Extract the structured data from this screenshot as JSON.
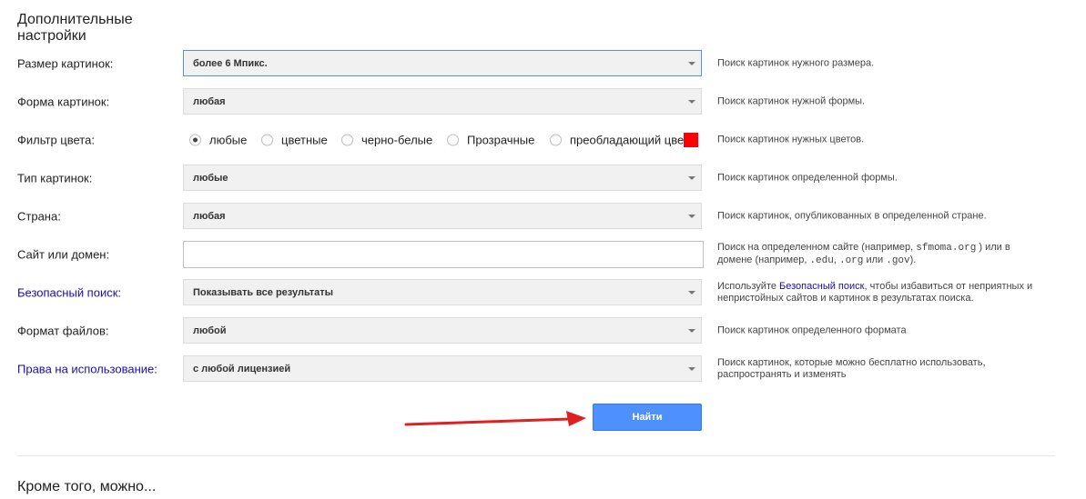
{
  "section_title": "Дополнительные настройки",
  "rows": [
    {
      "label": "Размер картинок:",
      "value": "более 6 Мпикс.",
      "help": "Поиск картинок нужного размера."
    },
    {
      "label": "Форма картинок:",
      "value": "любая",
      "help": "Поиск картинок нужной формы."
    },
    {
      "label": "Фильтр цвета:",
      "help": "Поиск картинок нужных цветов."
    },
    {
      "label": "Тип картинок:",
      "value": "любые",
      "help": "Поиск картинок определенной формы."
    },
    {
      "label": "Страна:",
      "value": "любая",
      "help": "Поиск картинок, опубликованных в определенной стране."
    },
    {
      "label": "Сайт или домен:",
      "value": ""
    },
    {
      "label": "Безопасный поиск:",
      "value": "Показывать все результаты"
    },
    {
      "label": "Формат файлов:",
      "value": "любой",
      "help": "Поиск картинок определенного формата"
    },
    {
      "label": "Права на использование:",
      "value": "с любой лицензией",
      "help": "Поиск картинок, которые можно бесплатно использовать, распространять и изменять"
    }
  ],
  "color_filter": {
    "options": [
      "любые",
      "цветные",
      "черно-белые",
      "Прозрачные",
      "преобладающий цве"
    ],
    "selected": "любые",
    "swatch_color": "#ff0000"
  },
  "site_help": {
    "part1": "Поиск на определенном сайте (например, ",
    "code1": "sfmoma.org",
    "part2": " ) или в домене (например, ",
    "code2": ".edu",
    "sep1": ", ",
    "code3": ".org",
    "part3": " или ",
    "code4": ".gov",
    "part4": ")."
  },
  "safe_help": {
    "part1": "Используйте ",
    "link": "Безопасный поиск",
    "part2": ", чтобы избавиться от неприятных и непристойных сайтов и картинок в результатах поиска."
  },
  "search_button": "Найти",
  "more_title": "Кроме того, можно...",
  "colors": {
    "accent": "#4d90fe",
    "link": "#1a0dab",
    "arrow": "#e02020"
  }
}
